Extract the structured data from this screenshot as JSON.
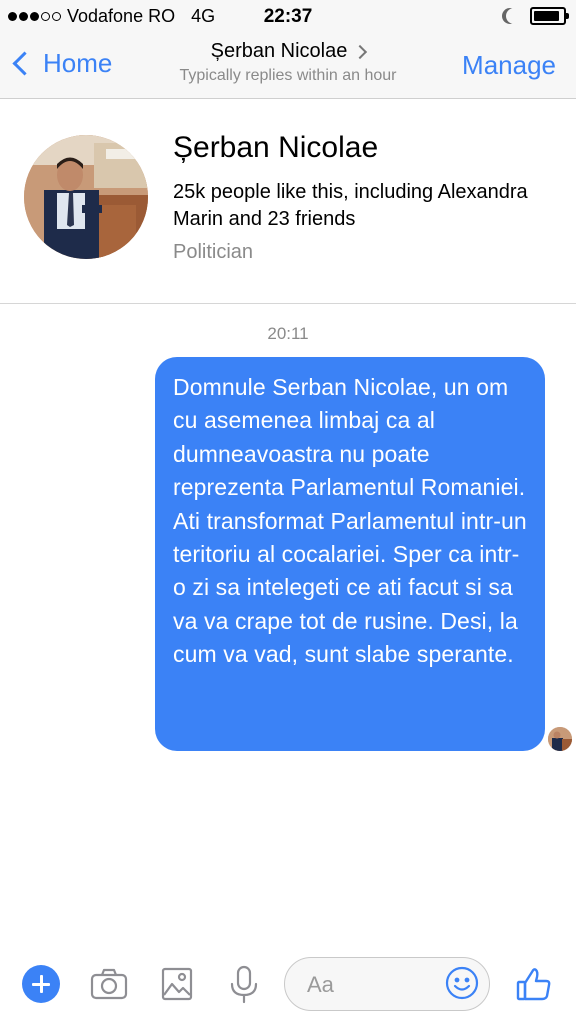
{
  "status_bar": {
    "carrier": "Vodafone RO",
    "network": "4G",
    "time": "22:37",
    "signal_bars": 3,
    "signal_total": 5
  },
  "nav": {
    "back_label": "Home",
    "title": "Șerban Nicolae",
    "subtitle": "Typically replies within an hour",
    "manage_label": "Manage"
  },
  "profile": {
    "name": "Șerban Nicolae",
    "likes": "25k people like this, including Alexandra Marin and 23 friends",
    "category": "Politician"
  },
  "conversation": {
    "timestamp": "20:11",
    "messages": [
      {
        "direction": "outgoing",
        "text": "Domnule Serban Nicolae, un om cu asemenea limbaj ca al dumneavoastra nu poate reprezenta Parlamentul Romaniei. Ati transformat Parlamentul intr-un teritoriu al cocalariei. Sper ca intr-o zi sa intelegeti ce ati facut si sa va va crape tot de rusine. Desi, la cum va vad, sunt slabe sperante."
      }
    ]
  },
  "composer": {
    "placeholder": "Aa",
    "icons": [
      "plus-icon",
      "camera-icon",
      "photo-icon",
      "microphone-icon",
      "emoji-icon",
      "thumbs-up-icon"
    ]
  },
  "colors": {
    "accent": "#3b82f6",
    "bar_bg": "#f7f7f7",
    "muted_text": "#8a8a8a"
  }
}
